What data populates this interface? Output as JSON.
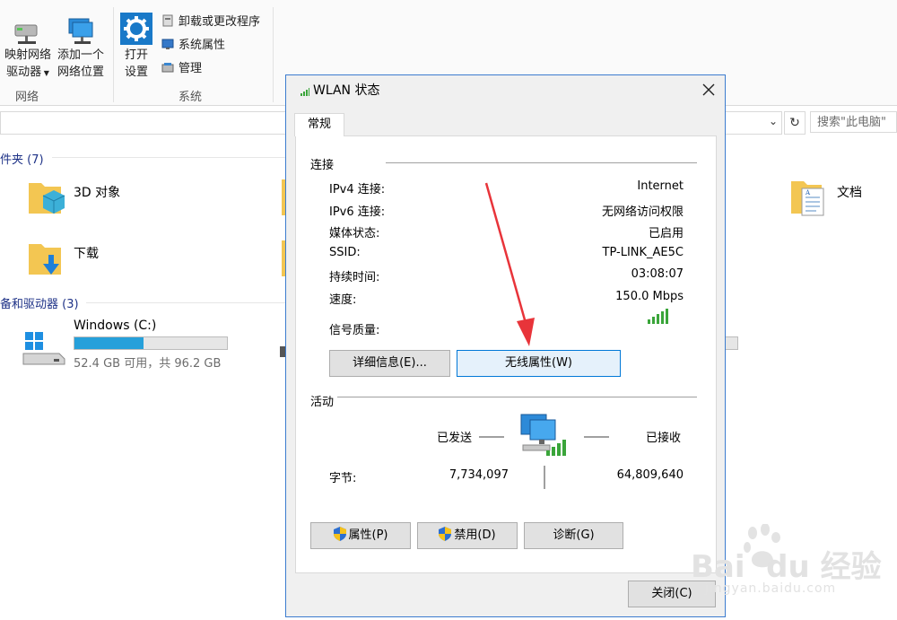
{
  "ribbon": {
    "map_drive_line1": "映射网络",
    "map_drive_line2": "驱动器",
    "add_location_line1": "添加一个",
    "add_location_line2": "网络位置",
    "network_group": "网络",
    "open_settings_line1": "打开",
    "open_settings_line2": "设置",
    "uninstall": "卸载或更改程序",
    "system_props": "系统属性",
    "manage": "管理",
    "system_group": "系统"
  },
  "search": {
    "placeholder": "搜索\"此电脑\""
  },
  "explorer": {
    "folders_header": "件夹 (7)",
    "folder_3d": "3D 对象",
    "folder_docs": "文档",
    "folder_downloads": "下载",
    "drives_header": "备和驱动器 (3)",
    "drive_c_name": "Windows (C:)",
    "drive_c_space": "52.4 GB 可用，共 96.2 GB",
    "drive_c_used_fraction": 0.455
  },
  "dialog": {
    "title": "WLAN 状态",
    "tab_general": "常规",
    "connection_group": "连接",
    "rows": [
      {
        "label": "IPv4 连接:",
        "value": "Internet"
      },
      {
        "label": "IPv6 连接:",
        "value": "无网络访问权限"
      },
      {
        "label": "媒体状态:",
        "value": "已启用"
      },
      {
        "label": "SSID:",
        "value": "TP-LINK_AE5C"
      },
      {
        "label": "持续时间:",
        "value": "03:08:07"
      },
      {
        "label": "速度:",
        "value": "150.0 Mbps"
      }
    ],
    "signal_label": "信号质量:",
    "details_button": "详细信息(E)...",
    "wireless_props_button": "无线属性(W)",
    "activity_group": "活动",
    "sent_label": "已发送",
    "received_label": "已接收",
    "bytes_label": "字节:",
    "bytes_sent": "7,734,097",
    "bytes_received": "64,809,640",
    "properties_button": "属性(P)",
    "disable_button": "禁用(D)",
    "diagnose_button": "诊断(G)",
    "close_button": "关闭(C)"
  },
  "watermark": {
    "brand": "Bai  du 经验",
    "url": "jingyan.baidu.com"
  },
  "colors": {
    "accent": "#0078d7",
    "annotation_arrow": "#e8343a",
    "signal": "#3aa53a",
    "drive_bar": "#26a0da"
  }
}
